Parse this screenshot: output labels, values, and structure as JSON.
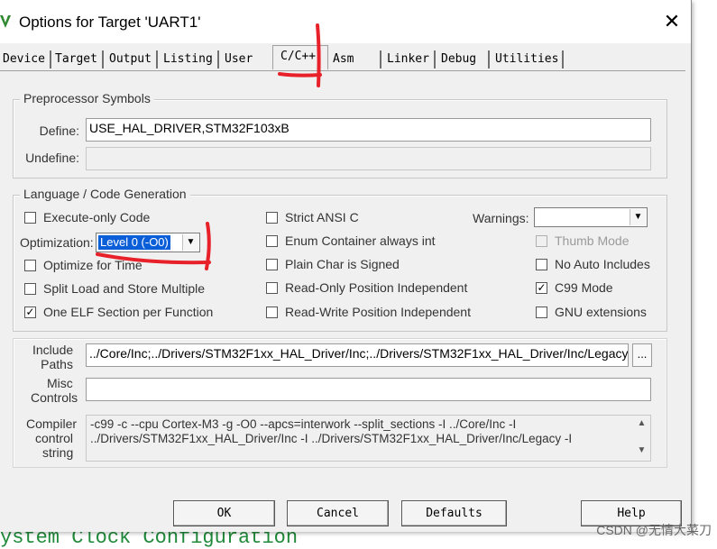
{
  "window": {
    "title": "Options for Target 'UART1'"
  },
  "tabs": [
    "Device",
    "Target",
    "Output",
    "Listing",
    "User",
    "C/C++",
    "Asm",
    "Linker",
    "Debug",
    "Utilities"
  ],
  "preprocessor": {
    "title": "Preprocessor Symbols",
    "define_label": "Define:",
    "define_value": "USE_HAL_DRIVER,STM32F103xB",
    "undefine_label": "Undefine:",
    "undefine_value": ""
  },
  "language": {
    "title": "Language / Code Generation",
    "execute_only": {
      "label": "Execute-only Code",
      "checked": false
    },
    "optimization_label": "Optimization:",
    "optimization_value": "Level 0 (-O0)",
    "optimize_time": {
      "label": "Optimize for Time",
      "checked": false
    },
    "split_load": {
      "label": "Split Load and Store Multiple",
      "checked": false
    },
    "one_elf": {
      "label": "One ELF Section per Function",
      "checked": true
    },
    "strict_ansi": {
      "label": "Strict ANSI C",
      "checked": false
    },
    "enum_container": {
      "label": "Enum Container always int",
      "checked": false
    },
    "plain_char": {
      "label": "Plain Char is Signed",
      "checked": false
    },
    "ro_pos": {
      "label": "Read-Only Position Independent",
      "checked": false
    },
    "rw_pos": {
      "label": "Read-Write Position Independent",
      "checked": false
    },
    "warnings_label": "Warnings:",
    "warnings_value": "",
    "thumb_mode": {
      "label": "Thumb Mode",
      "checked": false
    },
    "no_auto": {
      "label": "No Auto Includes",
      "checked": false
    },
    "c99": {
      "label": "C99 Mode",
      "checked": true
    },
    "gnu_ext": {
      "label": "GNU extensions",
      "checked": false
    }
  },
  "include": {
    "label_line1": "Include",
    "label_line2": "Paths",
    "value": "../Core/Inc;../Drivers/STM32F1xx_HAL_Driver/Inc;../Drivers/STM32F1xx_HAL_Driver/Inc/Legacy;",
    "browse": "..."
  },
  "misc": {
    "label_line1": "Misc",
    "label_line2": "Controls",
    "value": ""
  },
  "compiler": {
    "label_line1": "Compiler",
    "label_line2": "control",
    "label_line3": "string",
    "line1": "-c99 -c --cpu Cortex-M3 -g -O0 --apcs=interwork --split_sections -I ../Core/Inc -I",
    "line2": "../Drivers/STM32F1xx_HAL_Driver/Inc -I ../Drivers/STM32F1xx_HAL_Driver/Inc/Legacy -I"
  },
  "buttons": {
    "ok": "OK",
    "cancel": "Cancel",
    "defaults": "Defaults",
    "help": "Help"
  },
  "background": {
    "code_text": "ystem Clock Configuration"
  },
  "watermark": "CSDN @无情大菜刀",
  "icons": {
    "app": "keil-app-icon",
    "close": "close-icon",
    "checkmark": "✓"
  },
  "colors": {
    "highlight": "#0a5fd8",
    "annotation": "#e8202a",
    "code": "#1f8a3a"
  }
}
